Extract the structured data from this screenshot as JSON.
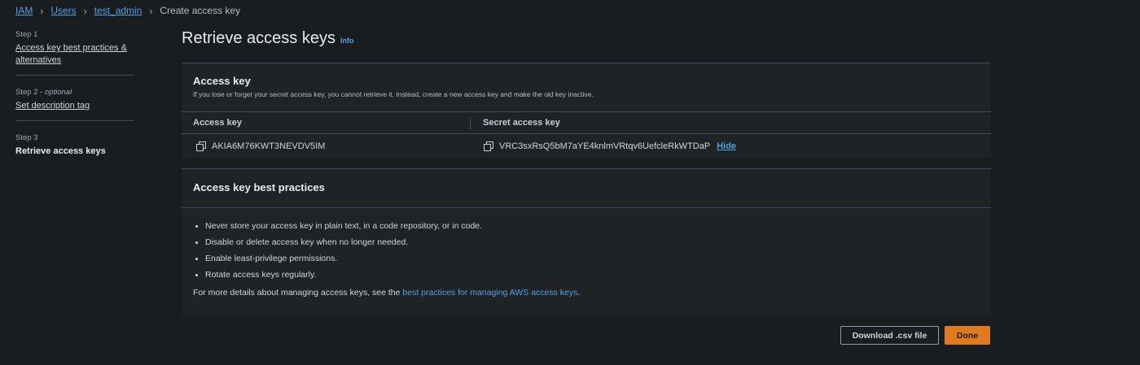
{
  "breadcrumb": {
    "items": [
      "IAM",
      "Users",
      "test_admin"
    ],
    "current": "Create access key"
  },
  "steps": [
    {
      "label": "Step 1",
      "optional": "",
      "title": "Access key best practices & alternatives"
    },
    {
      "label": "Step 2 - ",
      "optional": "optional",
      "title": "Set description tag"
    },
    {
      "label": "Step 3",
      "optional": "",
      "title": "Retrieve access keys"
    }
  ],
  "page": {
    "title": "Retrieve access keys",
    "info": "Info"
  },
  "access_key_panel": {
    "title": "Access key",
    "description": "If you lose or forget your secret access key, you cannot retrieve it. Instead, create a new access key and make the old key inactive.",
    "columns": [
      "Access key",
      "Secret access key"
    ],
    "access_key": "AKIA6M76KWT3NEVDV5IM",
    "secret_key": "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",
    "hide_label": "Hide"
  },
  "best_practices": {
    "title": "Access key best practices",
    "items": [
      "Never store your access key in plain text, in a code repository, or in code.",
      "Disable or delete access key when no longer needed.",
      "Enable least-privilege permissions.",
      "Rotate access keys regularly."
    ],
    "more_prefix": "For more details about managing access keys, see the ",
    "more_link": "best practices for managing AWS access keys",
    "more_suffix": "."
  },
  "buttons": {
    "download": "Download .csv file",
    "done": "Done"
  },
  "colors": {
    "background": "#1a1d1f",
    "link": "#539fe5",
    "primary_button": "#e07a1f"
  },
  "icons": [
    "chevron-right-icon",
    "copy-icon"
  ]
}
